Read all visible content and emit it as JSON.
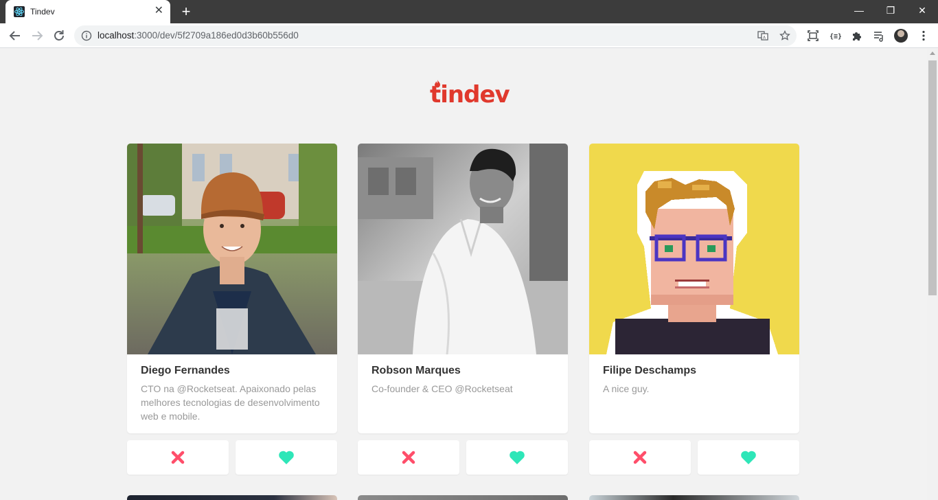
{
  "browser": {
    "tab_title": "Tindev",
    "tab_close": "✕",
    "new_tab": "+",
    "url_host": "localhost",
    "url_rest": ":3000/dev/5f2709a186ed0d3b60b556d0",
    "window_controls": {
      "minimize": "—",
      "restore": "❐",
      "close": "✕"
    }
  },
  "app": {
    "logo_text": "tindev",
    "logo_color": "#e0392d",
    "like_color": "#2ee6b8",
    "dislike_color": "#ff4e6a"
  },
  "devs": [
    {
      "name": "Diego Fernandes",
      "bio": "CTO na @Rocketseat. Apaixonado pelas melhores tecnologias de desenvolvimento web e mobile."
    },
    {
      "name": "Robson Marques",
      "bio": "Co-founder & CEO @Rocketseat"
    },
    {
      "name": "Filipe Deschamps",
      "bio": "A nice guy."
    }
  ]
}
